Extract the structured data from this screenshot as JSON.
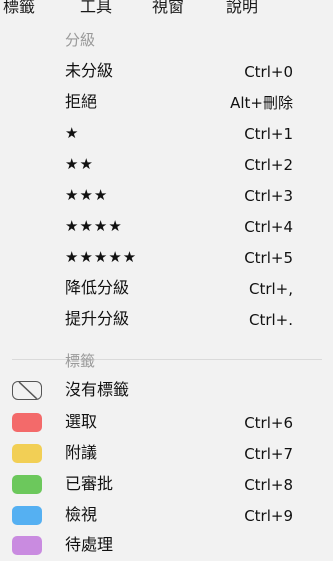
{
  "menubar": {
    "items": [
      "標籤",
      "工具",
      "視窗",
      "說明"
    ]
  },
  "rating_section": {
    "header": "分級",
    "items": [
      {
        "label": "未分級",
        "shortcut": "Ctrl+0"
      },
      {
        "label": "拒絕",
        "shortcut": "Alt+刪除"
      },
      {
        "label": "★",
        "shortcut": "Ctrl+1"
      },
      {
        "label": "★★",
        "shortcut": "Ctrl+2"
      },
      {
        "label": "★★★",
        "shortcut": "Ctrl+3"
      },
      {
        "label": "★★★★",
        "shortcut": "Ctrl+4"
      },
      {
        "label": "★★★★★",
        "shortcut": "Ctrl+5"
      },
      {
        "label": "降低分級",
        "shortcut": "Ctrl+,"
      },
      {
        "label": "提升分級",
        "shortcut": "Ctrl+."
      }
    ]
  },
  "label_section": {
    "header": "標籤",
    "items": [
      {
        "label": "沒有標籤",
        "shortcut": "",
        "icon": "no-label-icon"
      },
      {
        "label": "選取",
        "shortcut": "Ctrl+6",
        "color": "#f36a6a"
      },
      {
        "label": "附議",
        "shortcut": "Ctrl+7",
        "color": "#f2cf55"
      },
      {
        "label": "已審批",
        "shortcut": "Ctrl+8",
        "color": "#6cc85c"
      },
      {
        "label": "檢視",
        "shortcut": "Ctrl+9",
        "color": "#55b0f2"
      },
      {
        "label": "待處理",
        "shortcut": "",
        "color": "#c98be0"
      }
    ]
  }
}
